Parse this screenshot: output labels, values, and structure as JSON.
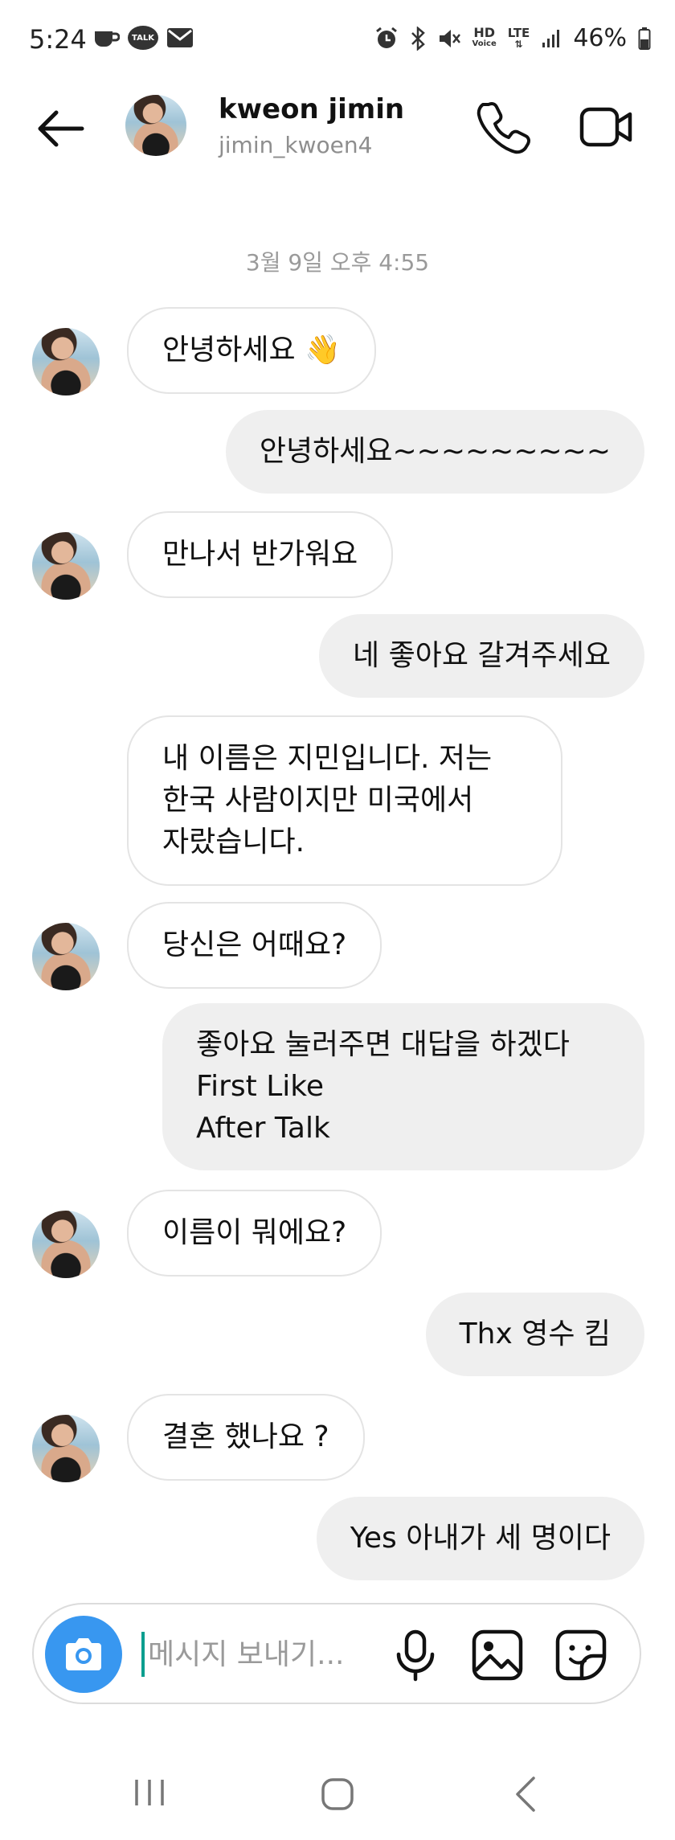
{
  "status_bar": {
    "time": "5:24",
    "talk_badge": "TALK",
    "hd_label": "HD",
    "voice_label": "Voice",
    "lte_label": "LTE",
    "battery": "46%"
  },
  "header": {
    "name": "kweon jimin",
    "username": "jimin_kwoen4"
  },
  "chat": {
    "timestamp": "3월 9일 오후 4:55",
    "messages": [
      {
        "from": "them",
        "text": "안녕하세요 👋"
      },
      {
        "from": "me",
        "text": "안녕하세요~~~~~~~~~"
      },
      {
        "from": "them",
        "text": "만나서 반가워요"
      },
      {
        "from": "me",
        "text": "네 좋아요 갈겨주세요"
      },
      {
        "from": "them",
        "text": "내 이름은 지민입니다. 저는\n한국 사람이지만 미국에서\n자랐습니다."
      },
      {
        "from": "them",
        "text": "당신은 어때요?"
      },
      {
        "from": "me",
        "text": "좋아요 눌러주면 대답을 하겠다\nFirst Like\nAfter Talk"
      },
      {
        "from": "them",
        "text": "이름이 뭐에요?"
      },
      {
        "from": "me",
        "text": "Thx 영수 킴"
      },
      {
        "from": "them",
        "text": "결혼 했나요 ?"
      },
      {
        "from": "me",
        "text": "Yes 아내가 세 명이다"
      }
    ]
  },
  "composer": {
    "placeholder": "메시지 보내기..."
  },
  "colors": {
    "accent": "#3897f0",
    "outgoing_bubble": "#efefef",
    "incoming_border": "#e4e4e4"
  }
}
